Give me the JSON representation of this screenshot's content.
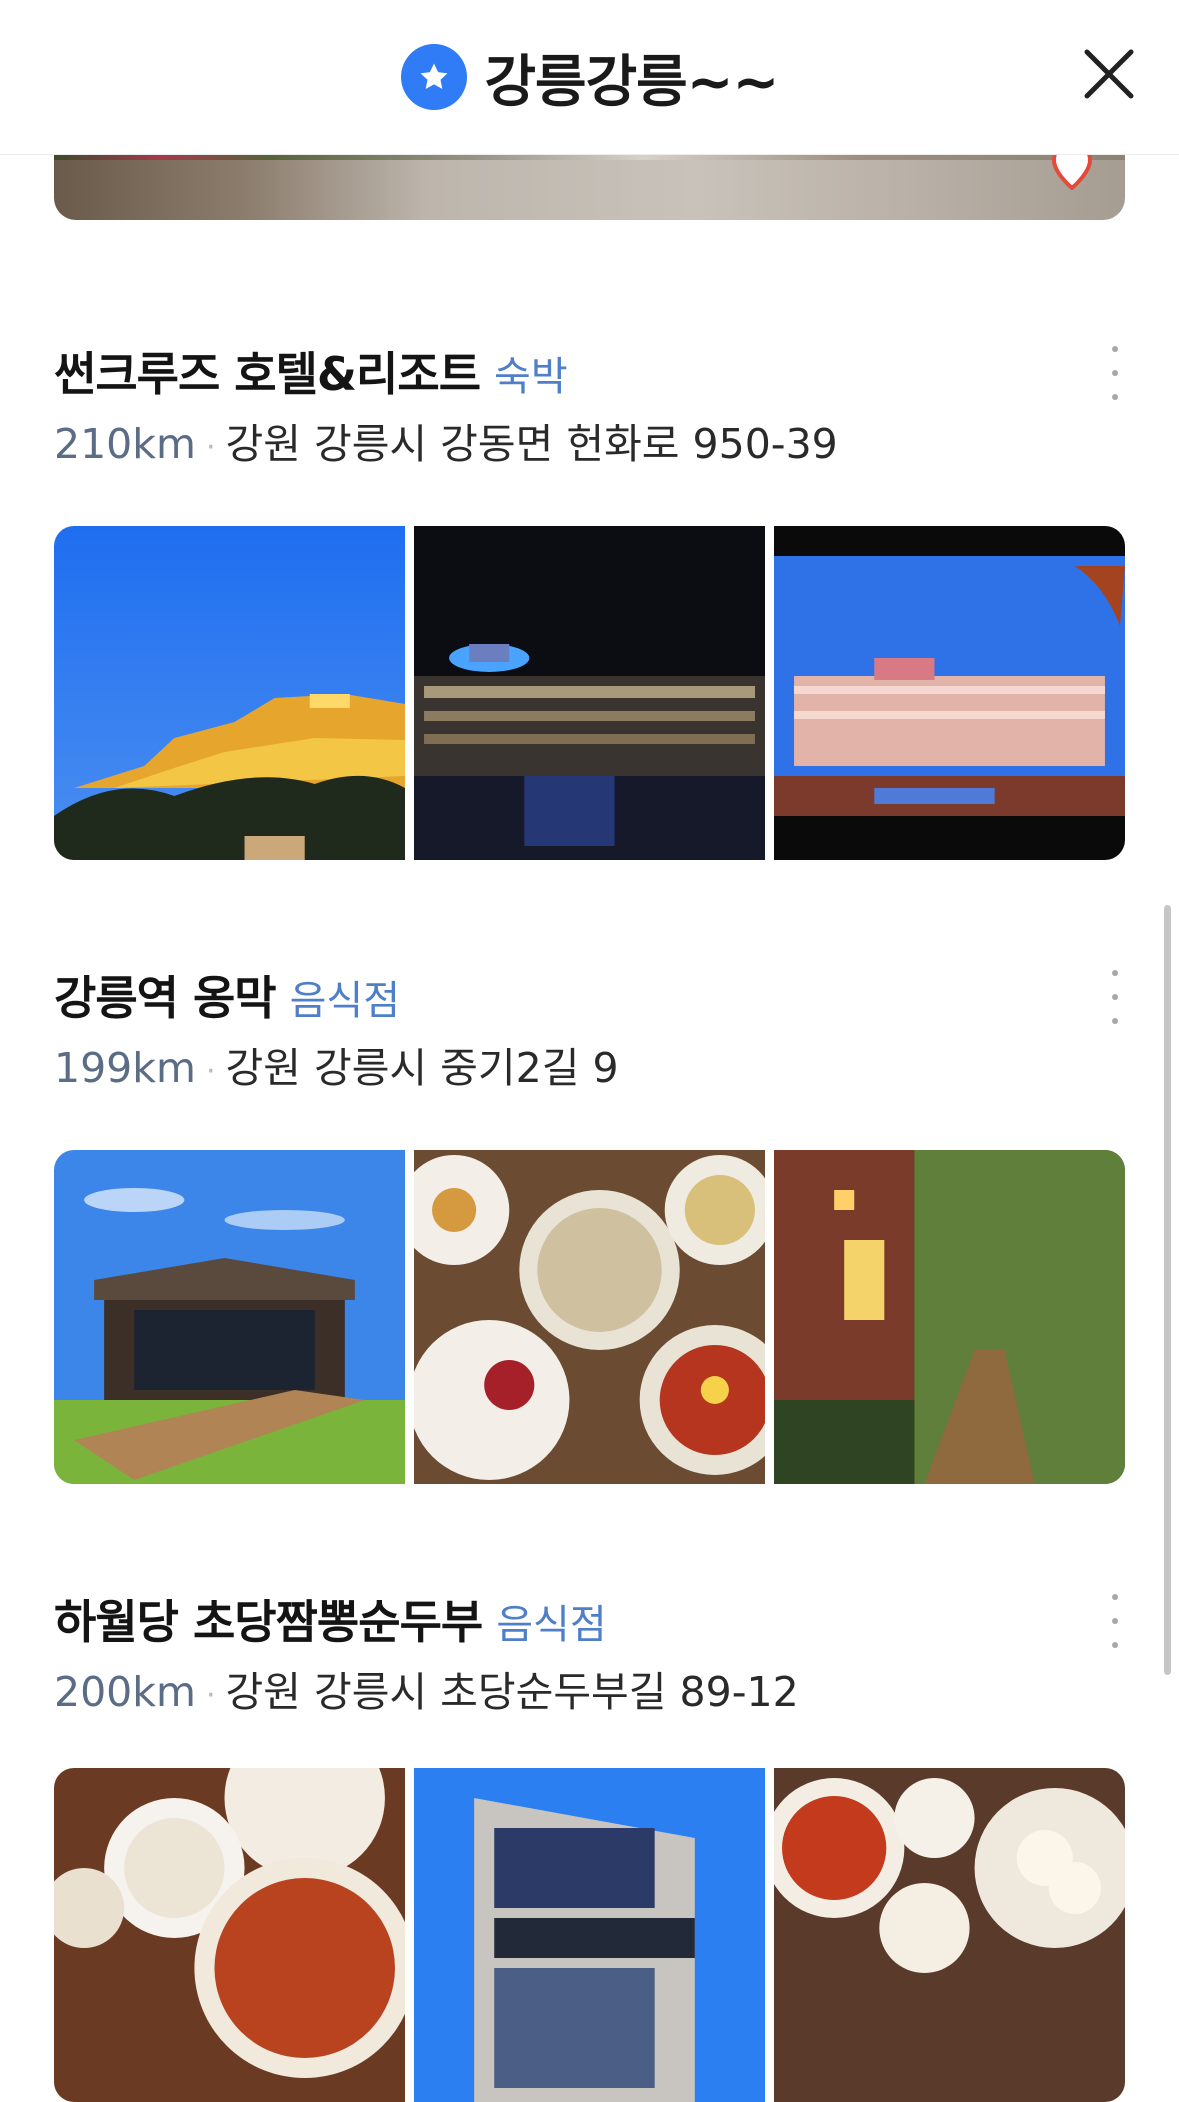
{
  "header": {
    "title": "강릉강릉~~",
    "star_icon": "star-icon",
    "close_icon": "close-icon",
    "accent": "#2f7cf6"
  },
  "places": [
    {
      "name": "썬크루즈 호텔&리조트",
      "category": "숙박",
      "distance": "210km",
      "address": "강원 강릉시 강동면 헌화로 950-39"
    },
    {
      "name": "강릉역 옹막",
      "category": "음식점",
      "distance": "199km",
      "address": "강원 강릉시 중기2길 9"
    },
    {
      "name": "하월당 초당짬뽕순두부",
      "category": "음식점",
      "distance": "200km",
      "address": "강원 강릉시 초당순두부길 89-12"
    }
  ],
  "separator": "·",
  "colors": {
    "category": "#4f7fc8",
    "distance": "#5b6c86"
  }
}
